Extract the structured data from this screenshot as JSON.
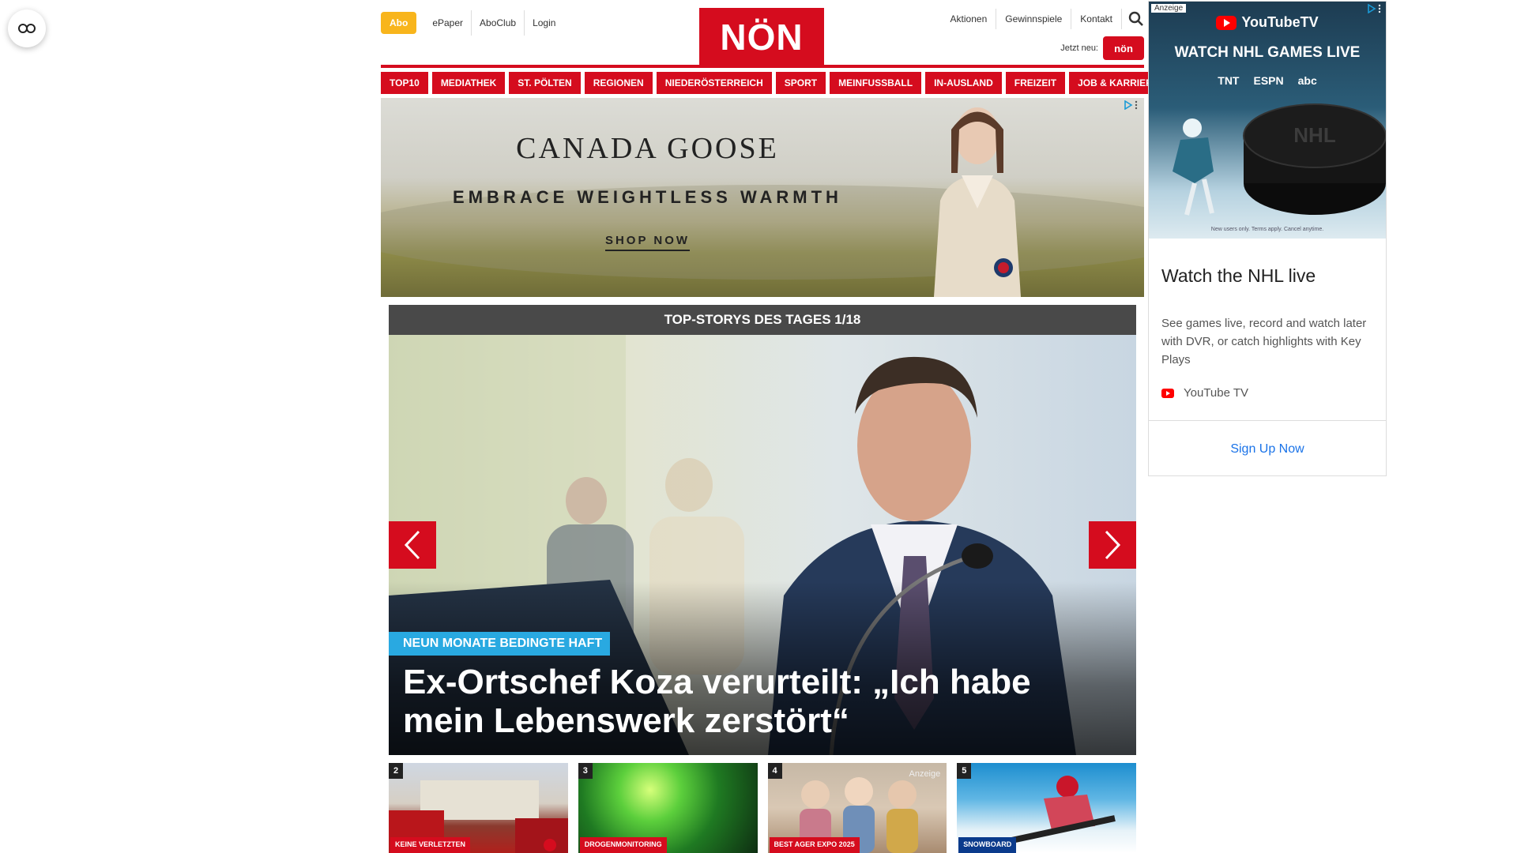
{
  "header": {
    "left_links": [
      "Abo",
      "ePaper",
      "AboClub",
      "Login"
    ],
    "logo": "NÖN",
    "right_links": [
      "Aktionen",
      "Gewinnspiele",
      "Kontakt"
    ],
    "jetzt_label": "Jetzt neu:",
    "jetzt_badge": "nön"
  },
  "nav": [
    "TOP10",
    "MEDIATHEK",
    "ST. PÖLTEN",
    "REGIONEN",
    "NIEDERÖSTERREICH",
    "SPORT",
    "MEINFUSSBALL",
    "IN-AUSLAND",
    "FREIZEIT",
    "JOB & KARRIERE"
  ],
  "banner": {
    "brand": "CANADA GOOSE",
    "tagline": "EMBRACE WEIGHTLESS WARMTH",
    "cta": "SHOP NOW"
  },
  "slider": {
    "title": "TOP-STORYS DES TAGES 1/18",
    "kicker": "NEUN MONATE BEDINGTE HAFT",
    "headline": "Ex-Ortschef Koza verurteilt: „Ich habe mein Lebenswerk zerstört“"
  },
  "thumbs": [
    {
      "num": "2",
      "label": "KEINE VERLETZTEN"
    },
    {
      "num": "3",
      "label": "DROGENMONITORING"
    },
    {
      "num": "4",
      "label": "BEST AGER EXPO 2025",
      "extra": "Anzeige"
    },
    {
      "num": "5",
      "label": "SNOWBOARD"
    }
  ],
  "side_ad": {
    "anzeige": "Anzeige",
    "logo": "YouTubeTV",
    "image_text": "WATCH NHL GAMES LIVE",
    "networks": [
      "TNT",
      "ESPN",
      "abc"
    ],
    "fine_print": "New users only. Terms apply. Cancel anytime.",
    "title": "Watch the NHL live",
    "description": "See games live, record and watch later with DVR, or catch highlights with Key Plays",
    "source": "YouTube TV",
    "cta": "Sign Up Now"
  },
  "colors": {
    "brand_red": "#d50c1e",
    "abo_yellow": "#f8b51c",
    "kicker_blue": "#29a9e1"
  }
}
